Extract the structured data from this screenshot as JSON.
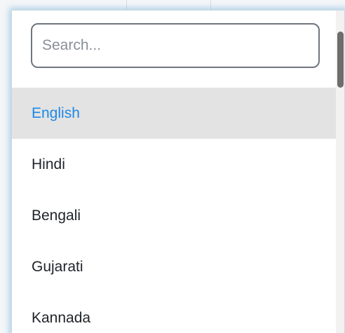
{
  "search": {
    "placeholder": "Search..."
  },
  "options": [
    {
      "label": "English",
      "selected": true
    },
    {
      "label": "Hindi",
      "selected": false
    },
    {
      "label": "Bengali",
      "selected": false
    },
    {
      "label": "Gujarati",
      "selected": false
    },
    {
      "label": "Kannada",
      "selected": false
    }
  ],
  "colors": {
    "selected_text": "#1e88e5",
    "selected_bg": "#e3e3e3",
    "focus_glow": "#78b4dc"
  }
}
